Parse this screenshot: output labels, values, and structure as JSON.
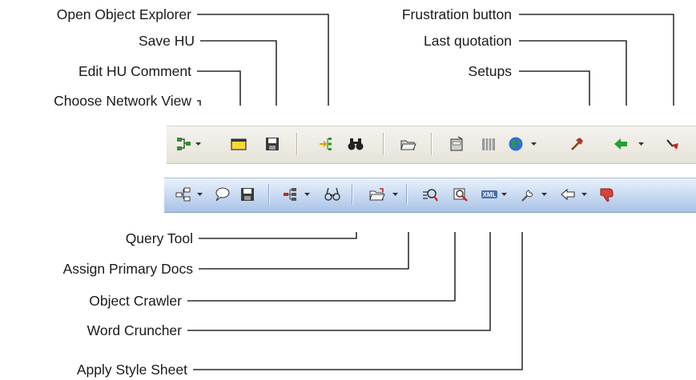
{
  "labels_top_left": {
    "open_object_explorer": "Open Object Explorer",
    "save_hu": "Save HU",
    "edit_hu_comment": "Edit HU Comment",
    "choose_network_view": "Choose Network View"
  },
  "labels_top_right": {
    "frustration_button": "Frustration button",
    "last_quotation": "Last quotation",
    "setups": "Setups"
  },
  "labels_bottom": {
    "query_tool": "Query Tool",
    "assign_primary_docs": "Assign Primary Docs",
    "object_crawler": "Object Crawler",
    "word_cruncher": "Word Cruncher",
    "apply_style_sheet": "Apply Style Sheet"
  },
  "toolbar_old": {
    "icons": [
      "network-view-icon",
      "hu-comment-icon",
      "save-icon",
      "object-explorer-icon",
      "query-binoculars-icon",
      "open-folder-icon",
      "setups-cabinet-icon",
      "columns-icon",
      "globe-icon",
      "hammer-icon",
      "back-arrow-icon",
      "frustration-icon"
    ]
  },
  "toolbar_new": {
    "icons": [
      "network-view-icon",
      "speech-bubble-icon",
      "save-icon",
      "object-explorer-icon",
      "binoculars-icon",
      "open-folder-icon",
      "object-crawler-icon",
      "word-cruncher-icon",
      "xml-icon",
      "wrench-icon",
      "back-arrow-icon",
      "thumbs-down-icon"
    ],
    "xml_text": "XML"
  },
  "colors": {
    "toolbar_old_bg": "#ece9d8",
    "toolbar_new_bg": "#c3d6ef",
    "accent_red": "#cc2222",
    "accent_green": "#22aa33"
  }
}
